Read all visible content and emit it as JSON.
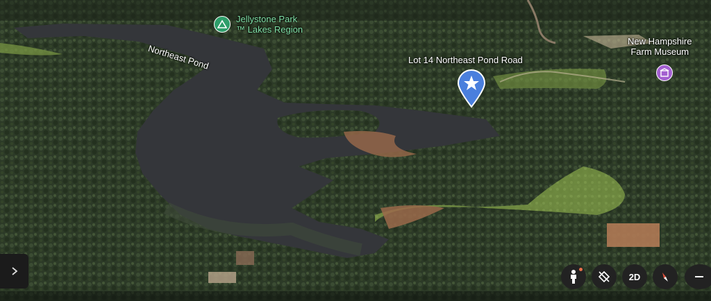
{
  "map": {
    "view_mode": "3D satellite",
    "places": {
      "lake": {
        "name": "Northeast Pond"
      },
      "park": {
        "name_line1": "Jellystone Park",
        "name_line2": "™ Lakes Region",
        "icon": "campground-icon"
      },
      "selected": {
        "name": "Lot 14 Northeast Pond Road",
        "icon": "star-marker-icon"
      },
      "museum": {
        "name_line1": "New Hampshire",
        "name_line2": "Farm Museum",
        "icon": "museum-icon"
      }
    },
    "colors": {
      "forest": "#2c3a27",
      "water": "#34363a",
      "field": "#7c9a45",
      "dirt": "#9b6a4b",
      "pin_blue": "#4a7fdd",
      "park_green": "#2e9e6a",
      "museum_purple": "#a35fd0"
    }
  },
  "controls": {
    "expand": {
      "icon": "chevron-right-icon"
    },
    "pegman": {
      "icon": "pegman-icon"
    },
    "rotate": {
      "icon": "rotate-view-icon"
    },
    "two_d": {
      "label": "2D"
    },
    "compass": {
      "icon": "compass-icon"
    },
    "zoom_out": {
      "icon": "minus-icon"
    }
  }
}
